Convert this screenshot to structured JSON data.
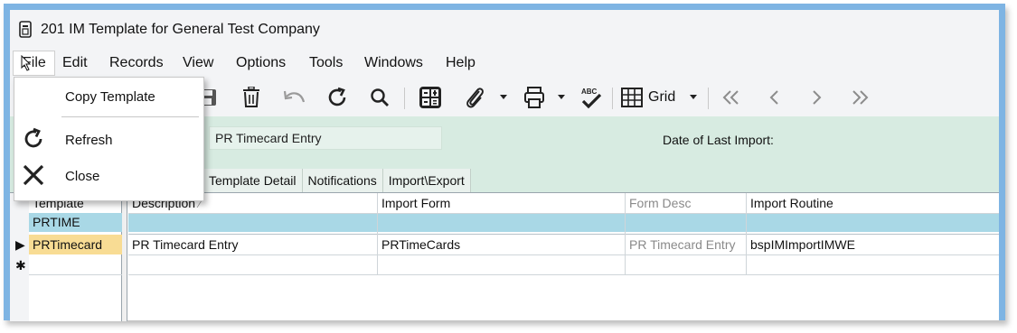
{
  "window": {
    "title": "201 IM Template for General Test Company"
  },
  "menubar": {
    "items": [
      "File",
      "Edit",
      "Records",
      "View",
      "Options",
      "Tools",
      "Windows",
      "Help"
    ]
  },
  "toolbar": {
    "grid_label": "Grid",
    "icons": [
      "save-icon",
      "delete-icon",
      "undo-icon",
      "refresh-icon",
      "find-icon",
      "calculator-icon",
      "attachment-icon",
      "print-icon",
      "spellcheck-icon",
      "grid-icon",
      "first-record-icon",
      "previous-record-icon",
      "next-record-icon",
      "last-record-icon"
    ]
  },
  "file_menu": {
    "items": [
      {
        "label": "Copy Template",
        "icon": ""
      },
      {
        "label": "Refresh",
        "icon": "refresh-icon"
      },
      {
        "label": "Close",
        "icon": "close-icon"
      }
    ]
  },
  "header": {
    "form_value": "PR Timecard Entry",
    "last_import_label": "Date of Last Import:"
  },
  "tabs": [
    "Template Detail",
    "Notifications",
    "Import\\Export"
  ],
  "left_grid": {
    "header": "Template",
    "filter_value": "PRTIME",
    "rows": [
      "PRTimecard",
      ""
    ]
  },
  "main_grid": {
    "columns": [
      "Description",
      "Import Form",
      "Form Desc",
      "Import Routine"
    ],
    "sort_indicator": "⁄",
    "rows": [
      [
        "PR Timecard Entry",
        "PRTimeCards",
        "PR Timecard Entry",
        "bspIMImportIMWE"
      ],
      [
        "",
        "",
        "",
        ""
      ]
    ]
  },
  "colors": {
    "frame_border": "#7eb4e3",
    "header_panel": "#d7ebe1",
    "filter_row": "#a9d8e6",
    "selected_cell": "#f8dc94"
  },
  "row_markers": {
    "current": "▶",
    "new": "✱"
  }
}
